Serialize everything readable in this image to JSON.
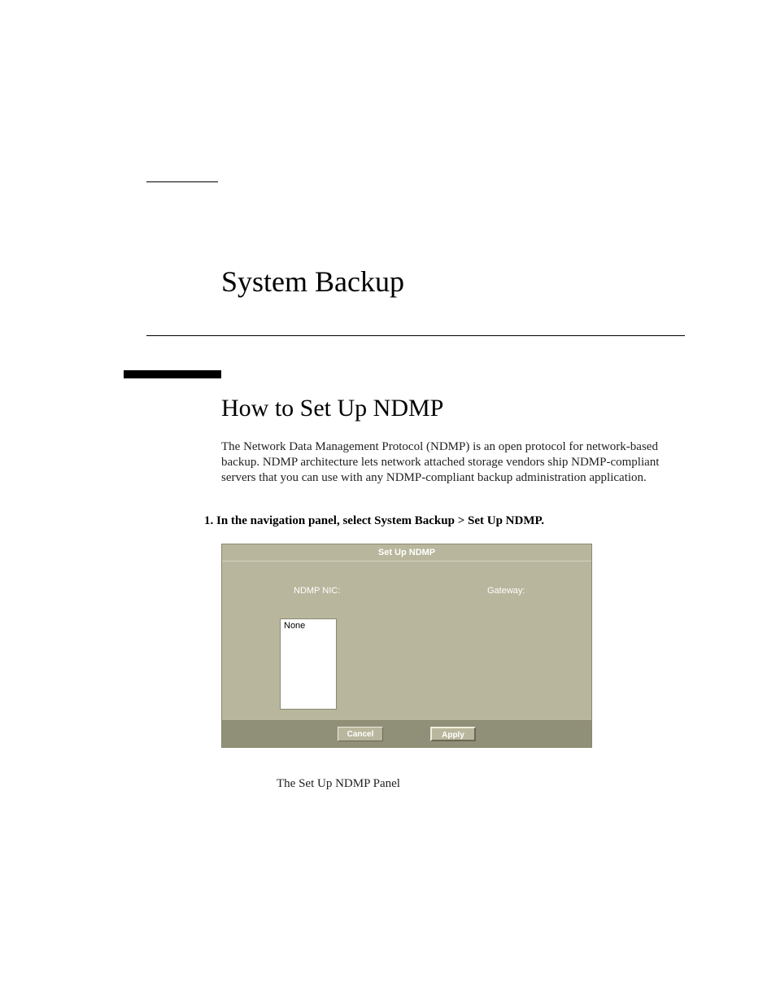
{
  "chapter": {
    "title": "System Backup"
  },
  "section": {
    "title": "How to Set Up NDMP",
    "body": "The Network Data Management Protocol (NDMP) is an open protocol for network-based backup. NDMP architecture lets network attached storage vendors ship NDMP-compliant servers that you can use with any NDMP-compliant backup administration application."
  },
  "step": {
    "number": "1.",
    "text": "In the navigation panel, select System Backup > Set Up NDMP."
  },
  "panel": {
    "title": "Set Up NDMP",
    "labels": {
      "nic": "NDMP NIC:",
      "gateway": "Gateway:"
    },
    "listbox_value": "None",
    "buttons": {
      "cancel": "Cancel",
      "apply": "Apply"
    }
  },
  "figure_caption": "The Set Up NDMP Panel"
}
